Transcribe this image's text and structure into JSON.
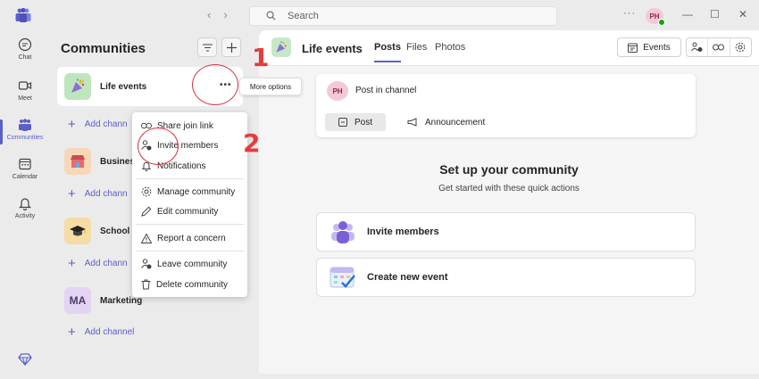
{
  "titlebar": {
    "search_placeholder": "Search",
    "more": "···",
    "user_initials": "PH",
    "back": "‹",
    "forward": "›",
    "minimize": "—",
    "maximize": "☐",
    "close": "✕"
  },
  "rail": {
    "items": [
      {
        "label": "Chat",
        "icon": "chat-icon"
      },
      {
        "label": "Meet",
        "icon": "video-icon"
      },
      {
        "label": "Communities",
        "icon": "communities-icon",
        "active": true
      },
      {
        "label": "Calendar",
        "icon": "calendar-icon"
      },
      {
        "label": "Activity",
        "icon": "bell-icon"
      }
    ],
    "bottom_icon": "diamond-icon"
  },
  "pane": {
    "title": "Communities",
    "communities": [
      {
        "name": "Life events",
        "avatar_icon": "party-popper-icon",
        "selected": true,
        "more": "•••"
      },
      {
        "name": "Business",
        "avatar_icon": "storefront-icon"
      },
      {
        "name": "School",
        "avatar_icon": "graduation-cap-icon"
      },
      {
        "name": "Marketing",
        "initials": "MA"
      }
    ],
    "add_channel": "Add channel",
    "add_channel_truncated": "Add chann"
  },
  "tooltip": {
    "text": "More options"
  },
  "menu": {
    "items": [
      {
        "label": "Share join link",
        "icon": "link-icon"
      },
      {
        "label": "Invite members",
        "icon": "person-add-icon"
      },
      {
        "label": "Notifications",
        "icon": "bell-icon"
      },
      {
        "label": "Manage community",
        "icon": "gear-icon"
      },
      {
        "label": "Edit community",
        "icon": "pencil-icon"
      },
      {
        "label": "Report a concern",
        "icon": "warning-icon"
      },
      {
        "label": "Leave community",
        "icon": "person-leave-icon"
      },
      {
        "label": "Delete community",
        "icon": "trash-icon"
      }
    ]
  },
  "annotations": {
    "step1": "1",
    "step2": "2"
  },
  "main": {
    "title": "Life events",
    "tabs": [
      "Posts",
      "Files",
      "Photos"
    ],
    "active_tab": "Posts",
    "events_button": "Events",
    "post_placeholder": "Post in channel",
    "post_initials": "PH",
    "post_button": "Post",
    "announcement_button": "Announcement",
    "setup_title": "Set up your community",
    "setup_subtitle": "Get started with these quick actions",
    "actions": [
      {
        "label": "Invite members",
        "icon": "invite-people-icon"
      },
      {
        "label": "Create new event",
        "icon": "calendar-event-icon"
      }
    ]
  },
  "colors": {
    "accent": "#5b5fc7",
    "annotation": "#e43b3b",
    "avatar_pink": "#f4c9d5",
    "presence_green": "#13a10e"
  }
}
